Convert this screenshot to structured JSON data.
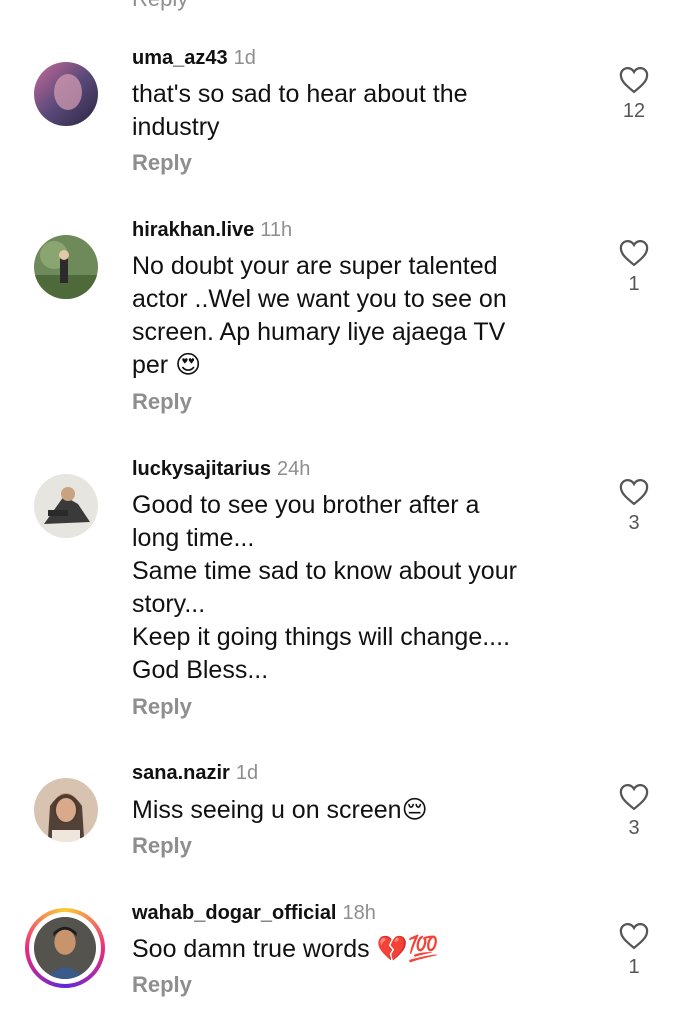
{
  "top_reply": "Reply",
  "comments": [
    {
      "username": "uma_az43",
      "time": "1d",
      "text": "that's so sad to hear about the\nindustry",
      "reply": "Reply",
      "likes": "12"
    },
    {
      "username": "hirakhan.live",
      "time": "11h",
      "text": "No doubt your are super talented\nactor ..Wel we want you to see on\nscreen. Ap humary liye ajaega TV\nper 😍",
      "reply": "Reply",
      "likes": "1"
    },
    {
      "username": "luckysajitarius",
      "time": "24h",
      "text": "Good to see you brother after a\nlong time...\nSame time sad to know about your\nstory...\nKeep it going things will change....\nGod Bless...",
      "reply": "Reply",
      "likes": "3"
    },
    {
      "username": "sana.nazir",
      "time": "1d",
      "text": "Miss seeing u on screen😔",
      "reply": "Reply",
      "likes": "3"
    },
    {
      "username": "wahab_dogar_official",
      "time": "18h",
      "text": "Soo damn true words 💔💯",
      "reply": "Reply",
      "likes": "1"
    }
  ],
  "icons": {
    "like": "heart-outline-icon"
  },
  "colors": {
    "secondary_text": "#8e8e8e",
    "primary_text": "#111111",
    "story_ring_start": "#f9ce34",
    "story_ring_mid": "#ee2a7b"
  }
}
